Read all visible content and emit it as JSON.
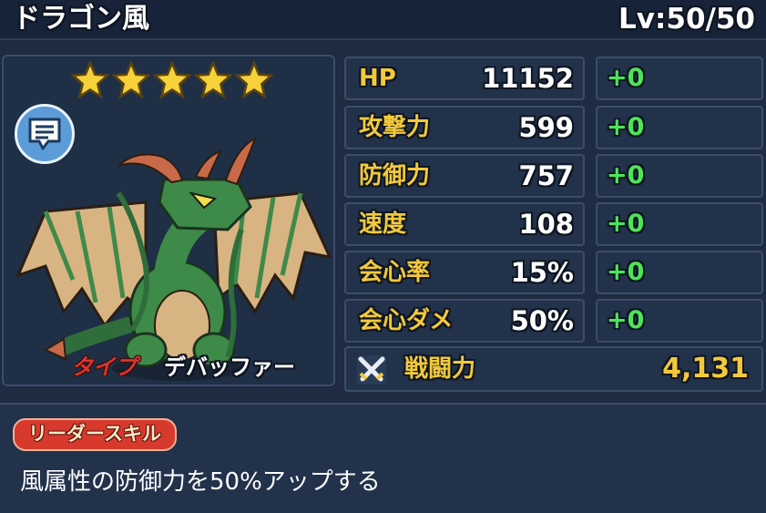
{
  "header": {
    "name": "ドラゴン風",
    "level": "Lv:50/50"
  },
  "portrait": {
    "star_count": 5,
    "type_label": "タイプ",
    "type_value": "デバッファー",
    "colors": {
      "star": "#f6d13a",
      "chat_button": "#5b9bd8"
    }
  },
  "stats": [
    {
      "label": "HP",
      "value": "11152",
      "bonus": "+0"
    },
    {
      "label": "攻撃力",
      "value": "599",
      "bonus": "+0"
    },
    {
      "label": "防御力",
      "value": "757",
      "bonus": "+0"
    },
    {
      "label": "速度",
      "value": "108",
      "bonus": "+0"
    },
    {
      "label": "会心率",
      "value": "15%",
      "bonus": "+0"
    },
    {
      "label": "会心ダメ",
      "value": "50%",
      "bonus": "+0"
    }
  ],
  "power": {
    "label": "戦闘力",
    "value": "4,131"
  },
  "leader_skill": {
    "tag": "リーダースキル",
    "description": "風属性の防御力を50%アップする"
  },
  "colors": {
    "background": "#1e2b40",
    "panel": "#22324b",
    "label_yellow": "#f3c93b",
    "bonus_green": "#4fe35a",
    "skill_red": "#d8392d"
  }
}
